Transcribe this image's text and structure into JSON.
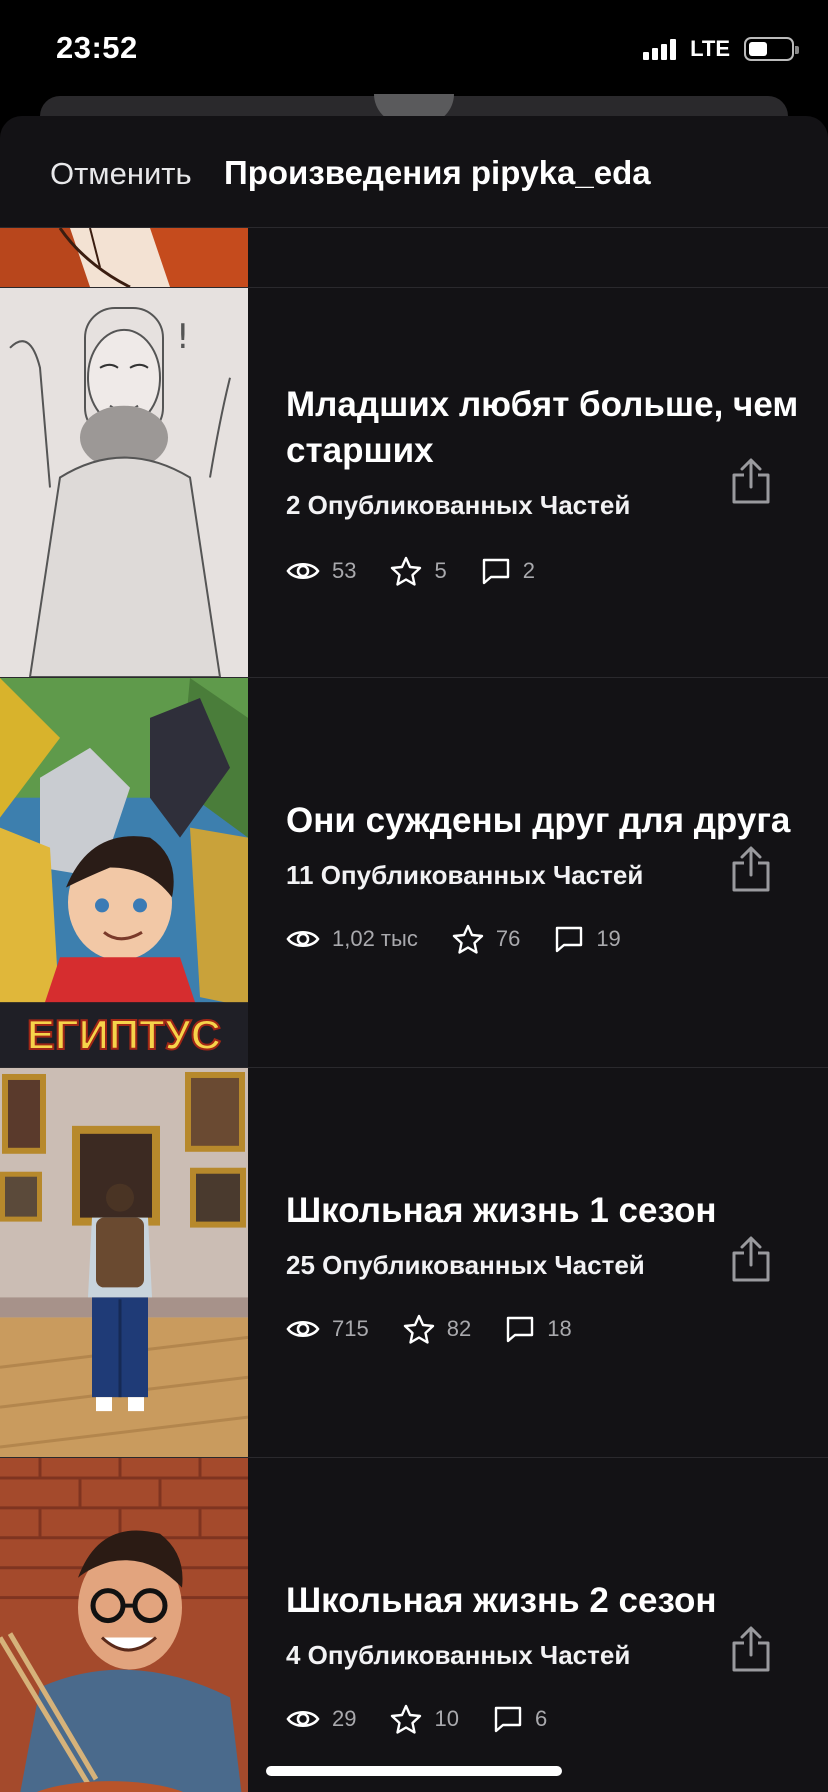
{
  "status_bar": {
    "time": "23:52",
    "network": "LTE",
    "battery_level": 0.45
  },
  "header": {
    "cancel_label": "Отменить",
    "title": "Произведения pipyka_eda"
  },
  "stories": [
    {
      "title": "Младших любят больше, чем старших",
      "parts": "2 Опубликованных Частей",
      "views": "53",
      "votes": "5",
      "comments": "2",
      "cover_icon": "pencil-sketch-cover"
    },
    {
      "title": "Они суждены друг для друга",
      "parts": "11 Опубликованных Частей",
      "views": "1,02 тыс",
      "votes": "76",
      "comments": "19",
      "cover_text": "ЕГИПТУС"
    },
    {
      "title": "Школьная жизнь 1 сезон",
      "parts": "25 Опубликованных Частей",
      "views": "715",
      "votes": "82",
      "comments": "18",
      "cover_icon": "museum-photo-cover"
    },
    {
      "title": "Школьная жизнь 2 сезон",
      "parts": "4 Опубликованных Частей",
      "views": "29",
      "votes": "10",
      "comments": "6",
      "cover_icon": "man-eating-photo-cover"
    }
  ],
  "colors": {
    "background": "#131215",
    "text": "#ffffff",
    "muted": "#a9a9ad",
    "divider": "#2a292d"
  }
}
